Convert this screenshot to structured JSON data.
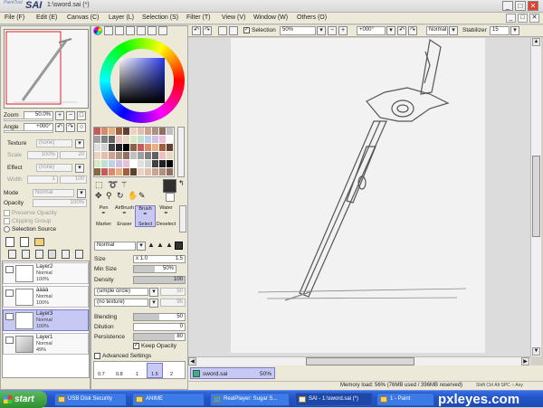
{
  "app": {
    "logo_small": "PaintTool",
    "logo_big": "SAI",
    "doc_title": "1:\\sword.sai (*)"
  },
  "window_buttons": [
    "_",
    "□",
    "✕"
  ],
  "menu": [
    {
      "label": "File (F)"
    },
    {
      "label": "Edit (E)"
    },
    {
      "label": "Canvas (C)"
    },
    {
      "label": "Layer (L)"
    },
    {
      "label": "Selection (S)"
    },
    {
      "label": "Filter (T)"
    },
    {
      "label": "View (V)"
    },
    {
      "label": "Window (W)"
    },
    {
      "label": "Others (O)"
    }
  ],
  "navigator": {
    "zoom_label": "Zoom",
    "zoom_value": "50.0%",
    "angle_label": "Angle",
    "angle_value": "+000°"
  },
  "texture": {
    "texture_label": "Texture",
    "texture_value": "(none)",
    "scale_label": "Scale",
    "scale_value": "100%",
    "scale_right": "20",
    "effect_label": "Effect",
    "effect_value": "(none)",
    "width_label": "Width",
    "width_value": "1",
    "width_right": "100"
  },
  "layer_props": {
    "mode_label": "Mode",
    "mode_value": "Normal",
    "opacity_label": "Opacity",
    "opacity_value": "100%",
    "preserve_opacity": "Preserve Opacity",
    "clipping_group": "Clipping Group",
    "selection_source": "Selection Source"
  },
  "layers": [
    {
      "name": "Layer2",
      "mode": "Normal",
      "opacity": "100%",
      "selected": false
    },
    {
      "name": "àààà",
      "mode": "Normal",
      "opacity": "100%",
      "selected": false
    },
    {
      "name": "Layer3",
      "mode": "Normal",
      "opacity": "100%",
      "selected": true
    },
    {
      "name": "Layer1",
      "mode": "Normal",
      "opacity": "49%",
      "selected": false
    }
  ],
  "tools": {
    "row1": [
      {
        "label": "Pen"
      },
      {
        "label": "AirBrush"
      },
      {
        "label": "Brush"
      },
      {
        "label": "Water"
      }
    ],
    "row2": [
      {
        "label": "Marker"
      },
      {
        "label": "Eraser"
      },
      {
        "label": "Select"
      },
      {
        "label": "Deselect"
      }
    ]
  },
  "brush": {
    "mode_value": "Normal",
    "size_label": "Size",
    "size_mult": "x 1.0",
    "size_value": "1.5",
    "min_size_label": "Min Size",
    "min_size_value": "50%",
    "density_label": "Density",
    "density_value": "100",
    "shape_value": "(simple circle)",
    "shape_right": "50",
    "texture_value": "(no texture)",
    "texture_right": "95",
    "blending_label": "Blending",
    "blending_value": "50",
    "dilution_label": "Dilution",
    "dilution_value": "0",
    "persistence_label": "Persistence",
    "persistence_value": "80",
    "keep_opacity": "Keep Opacity",
    "advanced": "Advanced Settings",
    "sizes": [
      "0.7",
      "0.8",
      "1",
      "1.5",
      "2"
    ]
  },
  "toolbar": {
    "selection_label": "Selection",
    "zoom_value": "50%",
    "angle_value": "+000°",
    "mode_value": "Normal",
    "stabilizer_label": "Stabilizer",
    "stabilizer_value": "15"
  },
  "canvas_tab": {
    "name": "sword.sai",
    "zoom": "50%"
  },
  "status": {
    "memory": "Memory load: 56% (76MB used / 396MB reserved)",
    "keys": "Shift Ctrl Alt SPC ○ Any"
  },
  "taskbar": {
    "start": "start",
    "tasks": [
      {
        "label": "USB Disk Security",
        "active": false
      },
      {
        "label": "ANIME",
        "active": false
      },
      {
        "label": "RealPlayer: Sugar S...",
        "active": false
      },
      {
        "label": "SAI - 1:\\sword.sai (*)",
        "active": true
      },
      {
        "label": "1 - Paint",
        "active": false
      }
    ],
    "watermark": "pxleyes.com"
  },
  "colors": {
    "accent": "#c8c8f4",
    "taskbar": "#2456c8",
    "current_color": "#303030"
  }
}
